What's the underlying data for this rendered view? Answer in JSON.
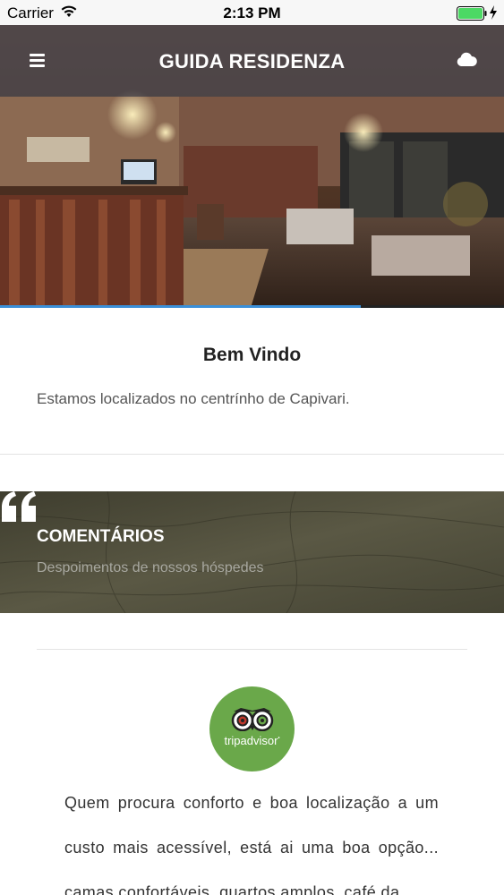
{
  "status_bar": {
    "carrier": "Carrier",
    "time": "2:13 PM"
  },
  "navbar": {
    "title": "GUIDA RESIDENZA",
    "menu_icon": "hamburger-menu-icon",
    "cloud_icon": "cloud-icon"
  },
  "slideshow": {
    "progress": 0.715,
    "progress_color": "#3a8fd8"
  },
  "welcome": {
    "title": "Bem Vindo",
    "text": "Estamos localizados no centrínho de Capivari."
  },
  "comments": {
    "title": "COMENTÁRIOS",
    "subtitle": "Despoimentos de nossos hóspedes",
    "icon": "quote-icon"
  },
  "review": {
    "source_logo": "tripadvisor",
    "logo_word_trip": "trip",
    "logo_word_advisor": "advisor",
    "text": "Quem procura conforto e boa localização a um custo mais acessível, está ai uma boa opção... camas confortáveis, quartos amplos, café da"
  },
  "colors": {
    "accent": "#3a8fd8",
    "tripadvisor_green": "#6aa84a"
  }
}
